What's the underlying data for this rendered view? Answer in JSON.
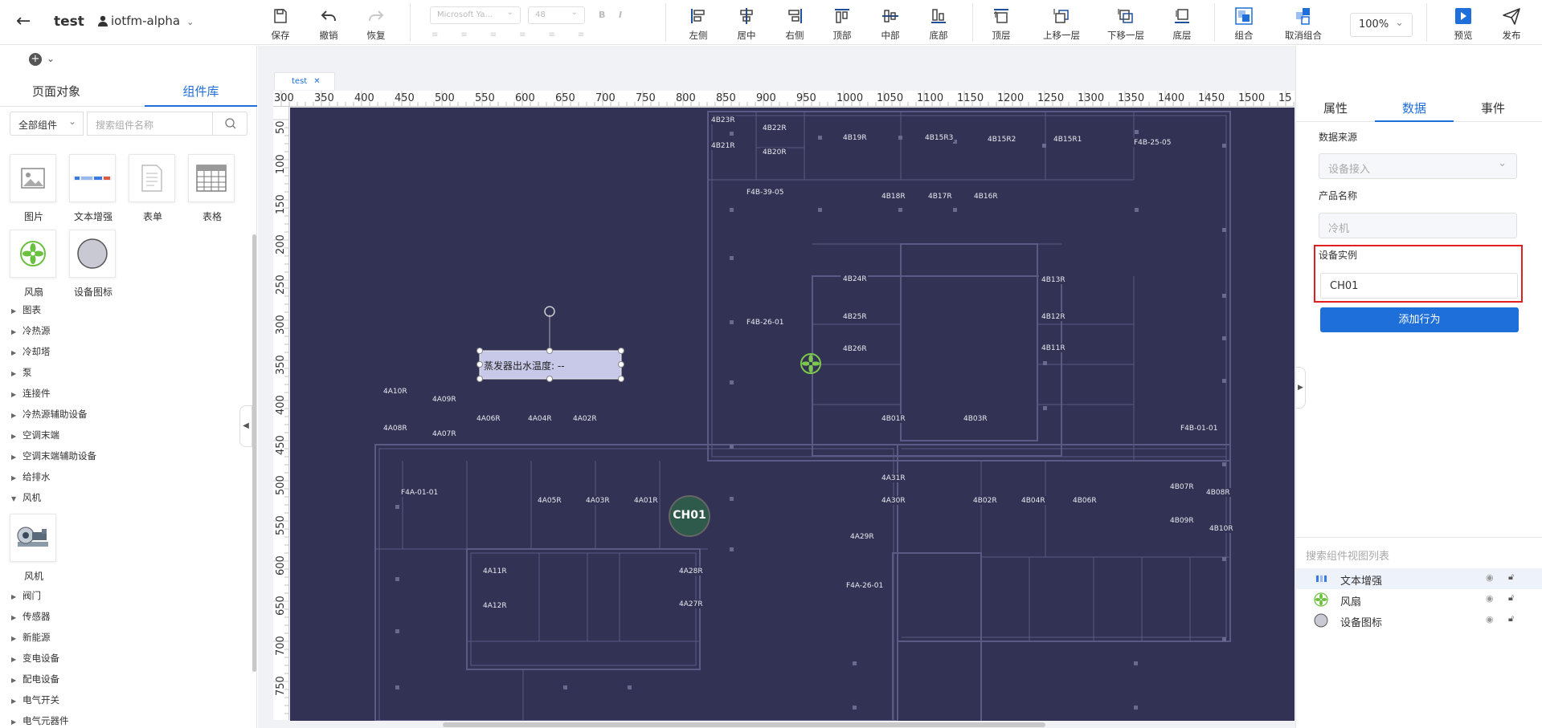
{
  "header": {
    "back_icon": "arrow-left-icon",
    "project_name": "test",
    "user_name": "iotfm-alpha",
    "toolbar": {
      "save": "保存",
      "undo": "撤销",
      "redo": "恢复",
      "font_family": "Microsoft Ya...",
      "font_size": "48",
      "align_left": "左侧",
      "align_center": "居中",
      "align_right": "右侧",
      "align_top": "顶部",
      "align_middle": "中部",
      "align_bottom": "底部",
      "bring_front": "顶层",
      "bring_forward": "上移一层",
      "send_backward": "下移一层",
      "send_back": "底层",
      "group": "组合",
      "ungroup": "取消组合",
      "zoom": "100%",
      "preview": "预览",
      "publish": "发布"
    }
  },
  "left_panel": {
    "tabs": [
      "页面对象",
      "组件库"
    ],
    "active_tab": 1,
    "category_select": "全部组件",
    "search_placeholder": "搜索组件名称",
    "components": [
      {
        "label": "图片",
        "icon": "image-icon"
      },
      {
        "label": "文本增强",
        "icon": "text-enhance-icon"
      },
      {
        "label": "表单",
        "icon": "form-icon"
      },
      {
        "label": "表格",
        "icon": "table-icon"
      },
      {
        "label": "风扇",
        "icon": "fan-icon"
      },
      {
        "label": "设备图标",
        "icon": "device-icon"
      }
    ],
    "tree_top": [
      "图表",
      "冷热源",
      "冷却塔",
      "泵",
      "连接件",
      "冷热源辅助设备",
      "空调末端",
      "空调末端辅助设备",
      "给排水"
    ],
    "tree_expanded": "风机",
    "expanded_items": [
      {
        "label": "风机",
        "icon": "blower-icon"
      }
    ],
    "tree_bottom": [
      "阀门",
      "传感器",
      "新能源",
      "变电设备",
      "配电设备",
      "电气开关",
      "电气元器件"
    ]
  },
  "canvas": {
    "doc_tab": "test",
    "ruler_x_labels": [
      "300",
      "350",
      "400",
      "450",
      "500",
      "550",
      "600",
      "650",
      "700",
      "750",
      "800",
      "850",
      "900",
      "950",
      "1000",
      "1050",
      "1100",
      "1150",
      "1200",
      "1250",
      "1300",
      "1350",
      "1400",
      "1450",
      "1500",
      "15"
    ],
    "ruler_y_labels": [
      "50",
      "100",
      "150",
      "200",
      "250",
      "300",
      "350",
      "400",
      "450",
      "500",
      "550",
      "600",
      "650",
      "700",
      "750"
    ],
    "text_widget": "蒸发器出水温度: --",
    "device_label": "CH01",
    "rooms": [
      "4B23R",
      "4B22R",
      "4B21R",
      "4B20R",
      "4B19R",
      "4B15R3",
      "4B15R2",
      "4B15R1",
      "F4B-25-05",
      "F4B-39-05",
      "4B18R",
      "4B17R",
      "4B16R",
      "4B24R",
      "4B13R",
      "F4B-26-01",
      "4B25R",
      "4B12R",
      "4B26R",
      "4B11R",
      "4A10R",
      "4A09R",
      "4A06R",
      "4A04R",
      "4A02R",
      "4B01R",
      "4B03R",
      "F4B-01-01",
      "4A08R",
      "4A07R",
      "F4A-01-01",
      "4A31R",
      "4B07R",
      "4B08R",
      "4A05R",
      "4A03R",
      "4A01R",
      "4A30R",
      "4B02R",
      "4B04R",
      "4B06R",
      "4B09R",
      "4B10R",
      "4A29R",
      "4A11R",
      "4A28R",
      "F4A-26-01",
      "4A27R",
      "4A12R"
    ]
  },
  "right_panel": {
    "tabs": [
      "属性",
      "数据",
      "事件"
    ],
    "active_tab": 1,
    "data_source_label": "数据来源",
    "data_source_value": "设备接入",
    "product_label": "产品名称",
    "product_value": "冷机",
    "instance_label": "设备实例",
    "instance_value": "CH01",
    "add_behavior_button": "添加行为",
    "layer_search_placeholder": "搜索组件视图列表",
    "layers": [
      {
        "name": "文本增强",
        "icon": "text-enhance-icon"
      },
      {
        "name": "风扇",
        "icon": "fan-icon"
      },
      {
        "name": "设备图标",
        "icon": "device-icon"
      }
    ]
  },
  "colors": {
    "accent": "#1e6fd9",
    "canvas_bg": "#323254",
    "plan_line": "#5a5a85",
    "device_green": "#2d5a4a",
    "highlight_red": "#e02020",
    "fan_green": "#7cc84a"
  }
}
